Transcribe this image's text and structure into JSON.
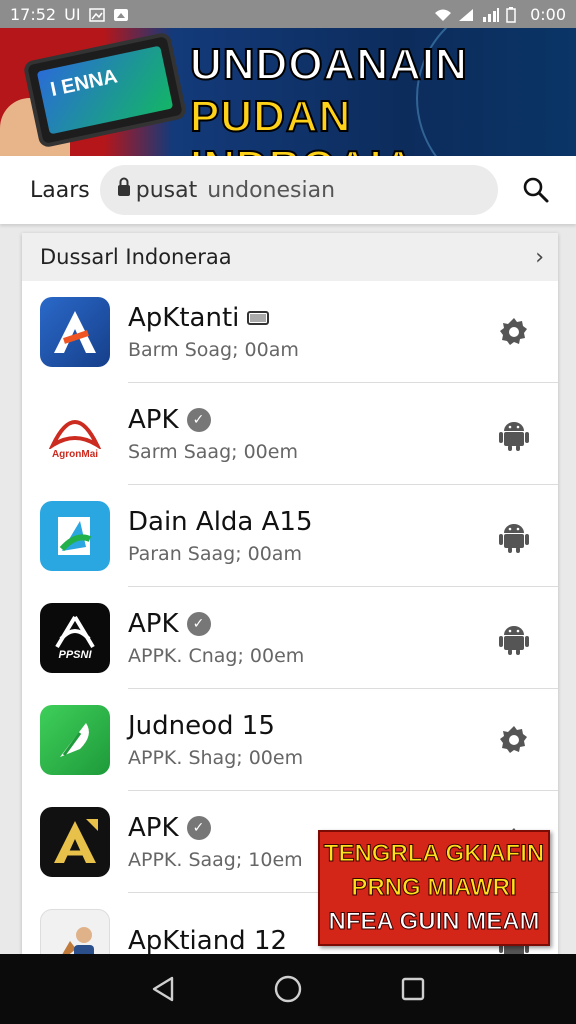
{
  "status_bar": {
    "time": "17:52",
    "carrier": "UI",
    "right_time": "0:00"
  },
  "banner": {
    "phone_text": "I ENNA",
    "line1": "UNDOANAIN",
    "line2": "PUDAN INDBOAIA"
  },
  "search": {
    "label": "Laars",
    "domain": "pusat",
    "query": "undonesian"
  },
  "list": {
    "header": "Dussarl Indoneraa",
    "items": [
      {
        "title": "ApKtanti",
        "subtitle": "Barm Soag; 00am",
        "icon_label": "A",
        "icon_color": "#1f55b5",
        "action_icon": "gear-icon"
      },
      {
        "title": "APK",
        "subtitle": "Sarm Saag; 00em",
        "icon_label": "AgronMai",
        "icon_color": "#ffffff",
        "action_icon": "android-icon"
      },
      {
        "title": "Dain Alda A15",
        "subtitle": "Paran Saag; 00am",
        "icon_label": "",
        "icon_color": "#2aa6e0",
        "action_icon": "android-icon"
      },
      {
        "title": "APK",
        "subtitle": "APPK. Cnag; 00em",
        "icon_label": "PPSNI",
        "icon_color": "#0a0a0a",
        "action_icon": "android-icon"
      },
      {
        "title": "Judneod 15",
        "subtitle": "APPK. Shag; 00em",
        "icon_label": "",
        "icon_color": "#2eb84a",
        "action_icon": "gear-icon"
      },
      {
        "title": "APK",
        "subtitle": "APPK. Saag; 10em",
        "icon_label": "A",
        "icon_color": "#111111",
        "action_icon": "gear-icon"
      },
      {
        "title": "ApKtiand 12",
        "subtitle": "",
        "icon_label": "",
        "icon_color": "#f1f1f1",
        "action_icon": "android-icon"
      }
    ]
  },
  "ad": {
    "line1": "TENGRLA GKIAFIN",
    "line2": "PRNG MIAWRI",
    "line3": "NFEA GUIN MEAM"
  }
}
